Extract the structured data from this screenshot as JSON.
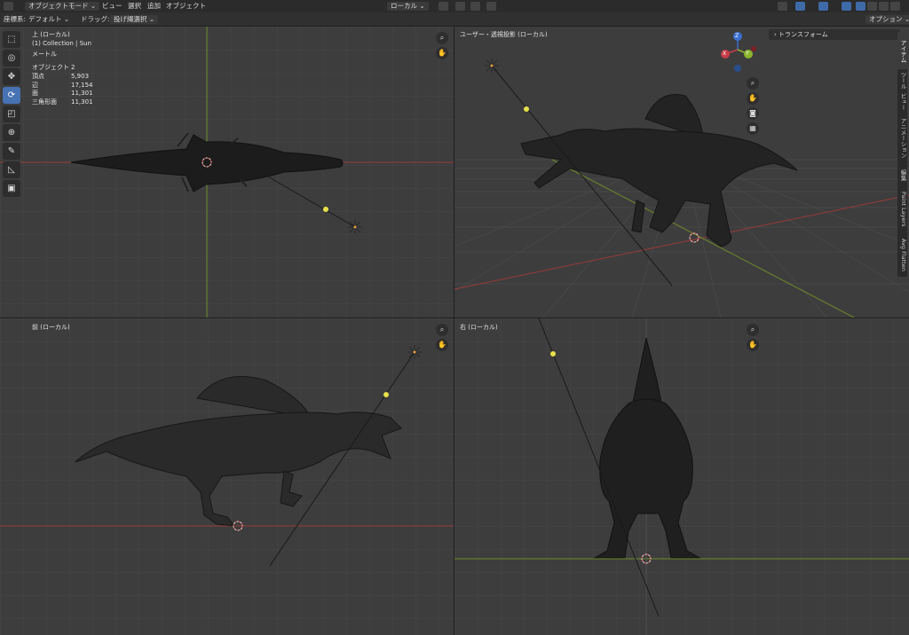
{
  "header": {
    "object_mode": "オブジェクトモード",
    "menus": [
      "ビュー",
      "選択",
      "追加",
      "オブジェクト"
    ],
    "transform_orientation": "ローカル"
  },
  "subheader": {
    "coord_label": "座標系:",
    "coord_value": "デフォルト",
    "drag_label": "ドラッグ:",
    "drag_value": "投げ縄選択",
    "options": "オプション"
  },
  "viewports": {
    "top": {
      "title": "上 (ローカル)",
      "collection": "(1) Collection | Sun",
      "unit": "メートル",
      "stats": [
        {
          "label": "オブジェクト",
          "value": "2"
        },
        {
          "label": "頂点",
          "value": "5,903"
        },
        {
          "label": "辺",
          "value": "17,154"
        },
        {
          "label": "面",
          "value": "11,301"
        },
        {
          "label": "三角形面",
          "value": "11,301"
        }
      ]
    },
    "user": {
      "title": "ユーザー・透視投影 (ローカル)"
    },
    "front": {
      "title": "前 (ローカル)"
    },
    "right": {
      "title": "右 (ローカル)"
    }
  },
  "sidebar": {
    "panel_title": "トランスフォーム",
    "tabs": [
      "アイテム",
      "ツール",
      "ビュー",
      "アニメーション",
      "編集",
      "Paint Layers",
      "Avg Flatten"
    ]
  },
  "gizmo": {
    "z": "Z",
    "x": "X",
    "y": "Y"
  },
  "colors": {
    "accent": "#4772b3",
    "x_axis": "#b5343a",
    "y_axis": "#7ea12c",
    "light_dot": "#e8e04a"
  }
}
